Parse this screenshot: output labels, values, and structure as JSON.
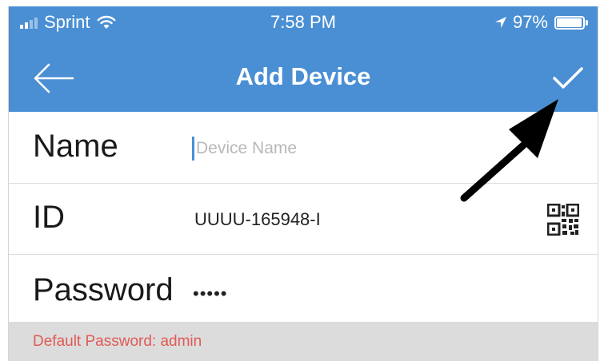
{
  "status_bar": {
    "carrier": "Sprint",
    "time": "7:58 PM",
    "battery": "97%",
    "battery_level": 0.97,
    "icons": [
      "signal-icon",
      "wifi-icon",
      "location-icon",
      "battery-icon"
    ]
  },
  "nav": {
    "title": "Add Device",
    "back_icon": "back-arrow-icon",
    "confirm_icon": "checkmark-icon"
  },
  "form": {
    "name_label": "Name",
    "name_placeholder": "Device Name",
    "name_value": "",
    "id_label": "ID",
    "id_value": "UUUU-165948-I",
    "id_action_icon": "qr-code-icon",
    "password_label": "Password",
    "password_value": "•••••"
  },
  "hint": {
    "text": "Default Password: admin"
  },
  "colors": {
    "accent": "#4a8fd4",
    "hint_red": "#e05a55",
    "hint_bg": "#dcdcdc"
  }
}
